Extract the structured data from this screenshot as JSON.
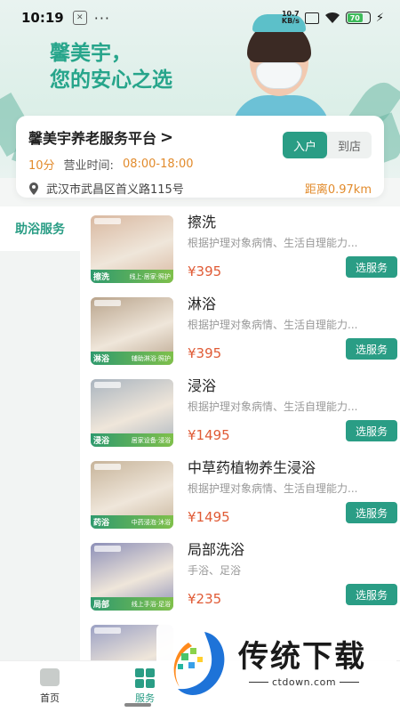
{
  "status_bar": {
    "time": "10:19",
    "dots": "···",
    "net_speed_value": "10.7",
    "net_speed_unit": "KB/s",
    "battery": "70"
  },
  "banner": {
    "line1": "馨美宇，",
    "line2": "您的安心之选"
  },
  "store": {
    "name": "馨美宇养老服务平台",
    "chevron": ">",
    "mode_options": [
      "入户",
      "到店"
    ],
    "active_mode": "入户",
    "eta": "10分",
    "hours_label": "营业时间:",
    "hours_value": "08:00-18:00",
    "address": "武汉市武昌区首义路115号",
    "distance": "距离0.97km"
  },
  "sidebar": {
    "items": [
      {
        "label": "助浴服务",
        "active": true
      }
    ]
  },
  "services": [
    {
      "title": "擦洗",
      "desc": "根据护理对象病情、生活自理能力...",
      "price": "¥395",
      "button": "选服务",
      "img_tag": "擦洗",
      "img_text": "线上·居家·照护",
      "img_color": "#d9b8a0"
    },
    {
      "title": "淋浴",
      "desc": "根据护理对象病情、生活自理能力...",
      "price": "¥395",
      "button": "选服务",
      "img_tag": "淋浴",
      "img_text": "辅助淋浴·照护",
      "img_color": "#b9a48c"
    },
    {
      "title": "浸浴",
      "desc": "根据护理对象病情、生活自理能力...",
      "price": "¥1495",
      "button": "选服务",
      "img_tag": "浸浴",
      "img_text": "居家设备·浸浴",
      "img_color": "#a9b4bf"
    },
    {
      "title": "中草药植物养生浸浴",
      "desc": "根据护理对象病情、生活自理能力...",
      "price": "¥1495",
      "button": "选服务",
      "img_tag": "药浴",
      "img_text": "中药浸泡·沐浴",
      "img_color": "#c7b49a"
    },
    {
      "title": "局部洗浴",
      "desc": "手浴、足浴",
      "price": "¥235",
      "button": "选服务",
      "img_tag": "局部",
      "img_text": "线上手浴·足浴",
      "img_color": "#8c8fb8"
    },
    {
      "title": "",
      "desc": "",
      "price": "",
      "button": "",
      "img_tag": "",
      "img_text": "",
      "img_color": "#9aa0c4"
    }
  ],
  "bottom_nav": {
    "items": [
      {
        "label": "首页",
        "icon": "home-icon"
      },
      {
        "label": "服务",
        "icon": "service-icon",
        "active": true
      }
    ]
  },
  "watermark": {
    "text": "传统下载",
    "url": "ctdown.com"
  },
  "colors": {
    "accent": "#2a9d85",
    "price": "#e05b36",
    "orange": "#e28b2c",
    "banner_text": "#27a58b"
  }
}
